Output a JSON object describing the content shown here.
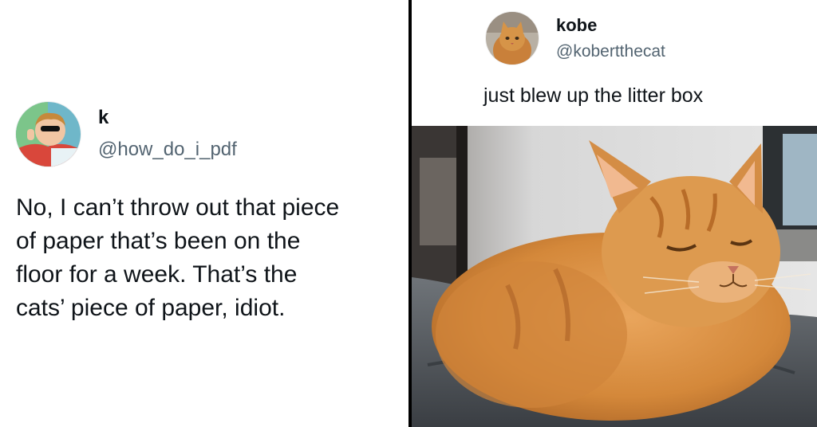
{
  "left_tweet": {
    "display_name": "k",
    "handle": "@how_do_i_pdf",
    "text": "No, I can’t throw out that piece\nof paper that’s been on the\nfloor for a week. That’s the\ncats’ piece of paper, idiot.",
    "avatar_icon": "profile-photo"
  },
  "right_tweet": {
    "display_name": "kobe",
    "handle": "@kobertthecat",
    "text": "just blew up the litter box",
    "avatar_icon": "cat-profile-photo",
    "photo_icon": "orange-cat-photo"
  },
  "colors": {
    "text_primary": "#0f1419",
    "text_secondary": "#536471",
    "divider": "#000000",
    "cat_orange": "#d68a3c"
  }
}
